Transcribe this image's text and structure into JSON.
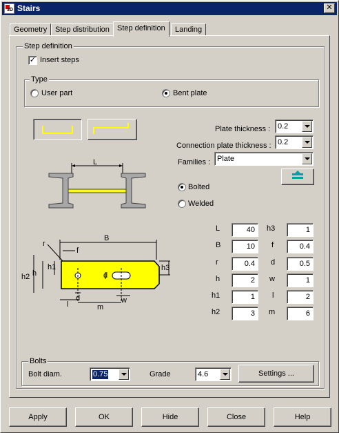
{
  "window": {
    "title": "Stairs",
    "app_icon_text": "3D"
  },
  "tabs": [
    "Geometry",
    "Step distribution",
    "Step definition",
    "Landing"
  ],
  "step_definition": {
    "group_label": "Step definition",
    "insert_steps_label": "Insert steps",
    "insert_steps_checked": true,
    "type_group_label": "Type",
    "type_options": [
      "User part",
      "Bent plate"
    ],
    "type_selected": "Bent plate",
    "plate_thickness_label": "Plate thickness :",
    "plate_thickness_value": "0.2",
    "connection_plate_thickness_label": "Connection plate thickness :",
    "connection_plate_thickness_value": "0.2",
    "families_label": "Families :",
    "families_value": "Plate",
    "fixing_options": [
      "Bolted",
      "Welded"
    ],
    "fixing_selected": "Bolted",
    "top_diagram_label": "L",
    "dim_labels": {
      "B": "B",
      "r": "r",
      "f": "f",
      "h": "h",
      "h1": "h1",
      "h2": "h2",
      "h3": "h3",
      "d": "d",
      "l": "l",
      "m": "m",
      "w": "w"
    }
  },
  "dimensions": {
    "left": [
      {
        "label": "L",
        "value": "40"
      },
      {
        "label": "B",
        "value": "10"
      },
      {
        "label": "r",
        "value": "0.4"
      },
      {
        "label": "h",
        "value": "2"
      },
      {
        "label": "h1",
        "value": "1"
      },
      {
        "label": "h2",
        "value": "3"
      }
    ],
    "right": [
      {
        "label": "h3",
        "value": "1"
      },
      {
        "label": "f",
        "value": "0.4"
      },
      {
        "label": "d",
        "value": "0.5"
      },
      {
        "label": "w",
        "value": "1"
      },
      {
        "label": "l",
        "value": "2"
      },
      {
        "label": "m",
        "value": "6"
      }
    ]
  },
  "bolts": {
    "group_label": "Bolts",
    "bolt_diam_label": "Bolt diam.",
    "bolt_diam_value": "0.75",
    "grade_label": "Grade",
    "grade_value": "4.6",
    "settings_label": "Settings ..."
  },
  "footer_buttons": [
    "Apply",
    "OK",
    "Hide",
    "Close",
    "Help"
  ],
  "colors": {
    "titlebar": "#0a246a",
    "face": "#d4d0c8",
    "step_yellow": "#ffff00"
  }
}
